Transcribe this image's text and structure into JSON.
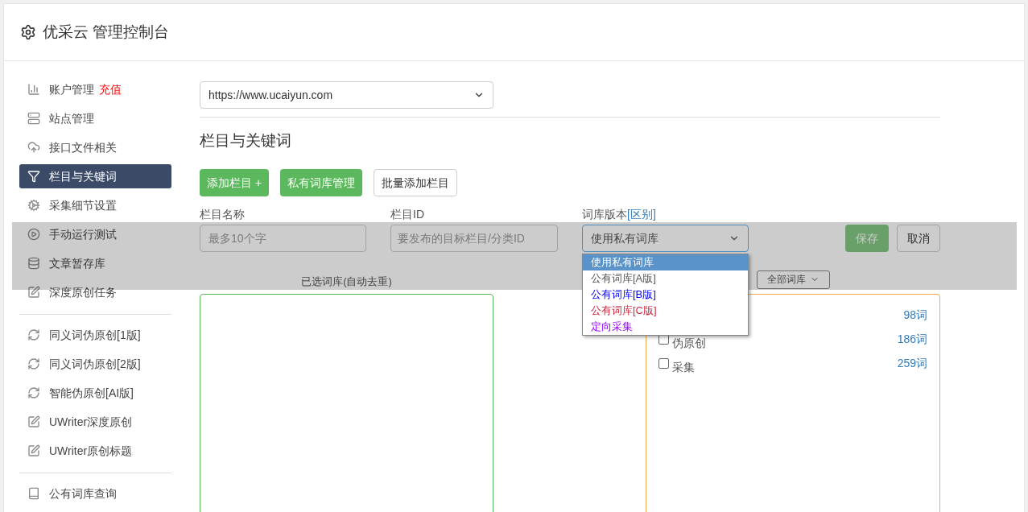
{
  "header": {
    "title": "优采云 管理控制台"
  },
  "sidebar": {
    "groups": [
      [
        {
          "label": "账户管理",
          "badge": "充值",
          "selected": false
        },
        {
          "label": "站点管理",
          "selected": false
        },
        {
          "label": "接口文件相关",
          "selected": false
        },
        {
          "label": "栏目与关键词",
          "selected": true
        },
        {
          "label": "采集细节设置",
          "selected": false
        },
        {
          "label": "手动运行测试",
          "selected": false
        },
        {
          "label": "文章暂存库",
          "selected": false
        },
        {
          "label": "深度原创任务",
          "selected": false
        }
      ],
      [
        {
          "label": "同义词伪原创[1版]",
          "selected": false
        },
        {
          "label": "同义词伪原创[2版]",
          "selected": false
        },
        {
          "label": "智能伪原创[AI版]",
          "selected": false
        },
        {
          "label": "UWriter深度原创",
          "selected": false
        },
        {
          "label": "UWriter原创标题",
          "selected": false
        }
      ],
      [
        {
          "label": "公有词库查询",
          "selected": false
        }
      ]
    ]
  },
  "site_select": {
    "value": "https://www.ucaiyun.com"
  },
  "section_title": "栏目与关键词",
  "buttons": [
    {
      "label": "添加栏目 +",
      "kind": "primary"
    },
    {
      "label": "私有词库管理",
      "kind": "primary"
    },
    {
      "label": "批量添加栏目",
      "kind": "default"
    }
  ],
  "form": {
    "name_field": {
      "label": "栏目名称",
      "placeholder": "最多10个字"
    },
    "id_field": {
      "label": "栏目ID",
      "placeholder": "要发布的目标栏目/分类ID"
    },
    "version_select": {
      "label": "词库版本",
      "link": "[区别]",
      "value": "使用私有词库",
      "expanded": true,
      "options": [
        {
          "label": "使用私有词库",
          "selected": true
        },
        {
          "label": "公有词库[A版]",
          "selected": false
        },
        {
          "label": "公有词库[B版]",
          "selected": false,
          "color": "#0000ff"
        },
        {
          "label": "公有词库[C版]",
          "selected": false,
          "color": "#d0243c"
        },
        {
          "label": "定向采集",
          "selected": false,
          "color": "#9900ff"
        }
      ]
    },
    "save": "保存",
    "cancel": "取消"
  },
  "selected_title": "已选词库(自动去重)",
  "filter_select": {
    "value": "全部词库"
  },
  "libraries": [
    {
      "count": "98词"
    },
    {
      "label": "伪原创",
      "checked": false,
      "count": "186词"
    },
    {
      "label": "采集",
      "checked": false,
      "count": "259词"
    }
  ]
}
